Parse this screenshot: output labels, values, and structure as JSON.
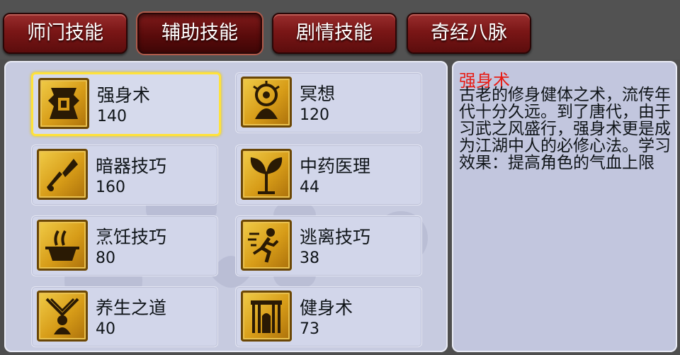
{
  "tabs": [
    {
      "label": "师门技能",
      "active": false
    },
    {
      "label": "辅助技能",
      "active": true
    },
    {
      "label": "剧情技能",
      "active": false
    },
    {
      "label": "奇经八脉",
      "active": false
    }
  ],
  "skills": [
    {
      "name": "强身术",
      "level": "140",
      "icon": "armor-icon",
      "selected": true
    },
    {
      "name": "冥想",
      "level": "120",
      "icon": "meditation-icon",
      "selected": false
    },
    {
      "name": "暗器技巧",
      "level": "160",
      "icon": "dart-icon",
      "selected": false
    },
    {
      "name": "中药医理",
      "level": "44",
      "icon": "herb-icon",
      "selected": false
    },
    {
      "name": "烹饪技巧",
      "level": "80",
      "icon": "cooking-pot-icon",
      "selected": false
    },
    {
      "name": "逃离技巧",
      "level": "38",
      "icon": "running-icon",
      "selected": false
    },
    {
      "name": "养生之道",
      "level": "40",
      "icon": "wellness-icon",
      "selected": false
    },
    {
      "name": "健身术",
      "level": "73",
      "icon": "gate-icon",
      "selected": false
    }
  ],
  "description": {
    "title": "强身术",
    "body": "古老的修身健体之术，流传年代十分久远。到了唐代，由于习武之风盛行，强身术更是成为江湖中人的必修心法。学习效果：提高角色的气血上限"
  },
  "colors": {
    "tab_red": "#7a1616",
    "panel": "#c7cbe0",
    "selected_border": "#ffe23a",
    "title_red": "#e81c14",
    "icon_gold": "#d79c18"
  }
}
